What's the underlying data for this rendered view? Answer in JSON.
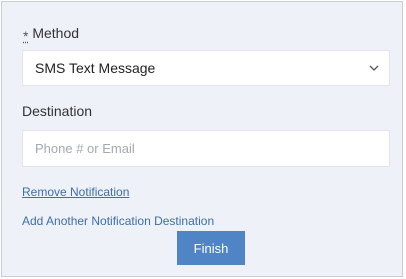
{
  "method": {
    "required_marker": "*",
    "label": "Method",
    "selected_value": "SMS Text Message",
    "dropdown_icon": "chevron-down-icon"
  },
  "destination": {
    "label": "Destination",
    "placeholder": "Phone # or Email",
    "value": ""
  },
  "actions": {
    "remove_link": "Remove Notification",
    "add_link": "Add Another Notification Destination",
    "finish_label": "Finish"
  },
  "colors": {
    "panel_background": "#eef1f8",
    "link": "#3d6fa8",
    "primary_button": "#4f84c5"
  }
}
